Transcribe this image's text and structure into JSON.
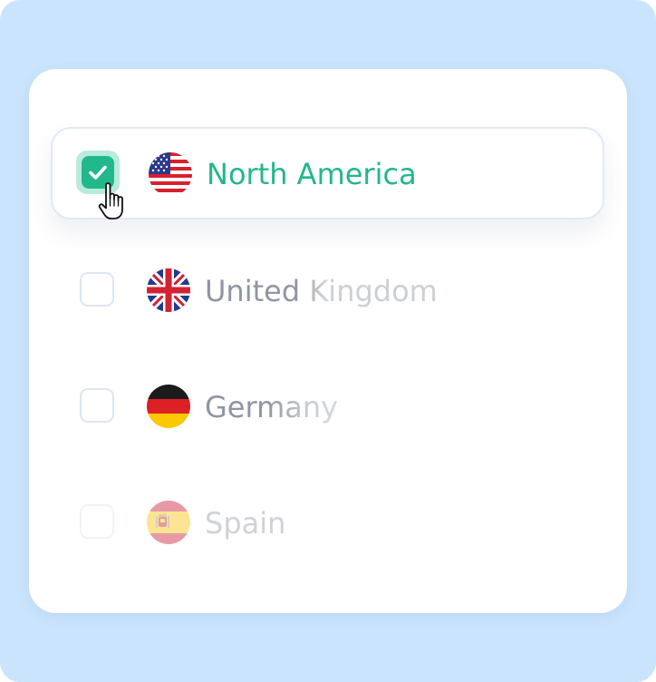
{
  "regions": [
    {
      "label": "North America",
      "checked": true,
      "flag_icon": "us-flag-icon"
    },
    {
      "label": "United Kingdom",
      "checked": false,
      "flag_icon": "uk-flag-icon"
    },
    {
      "label": "Germany",
      "checked": false,
      "flag_icon": "germany-flag-icon"
    },
    {
      "label": "Spain",
      "checked": false,
      "flag_icon": "spain-flag-icon"
    }
  ],
  "colors": {
    "background": "#cae4fd",
    "accent": "#23b78c",
    "text_muted": "#8f96a1"
  },
  "cursor_icon": "hand-pointer-icon"
}
